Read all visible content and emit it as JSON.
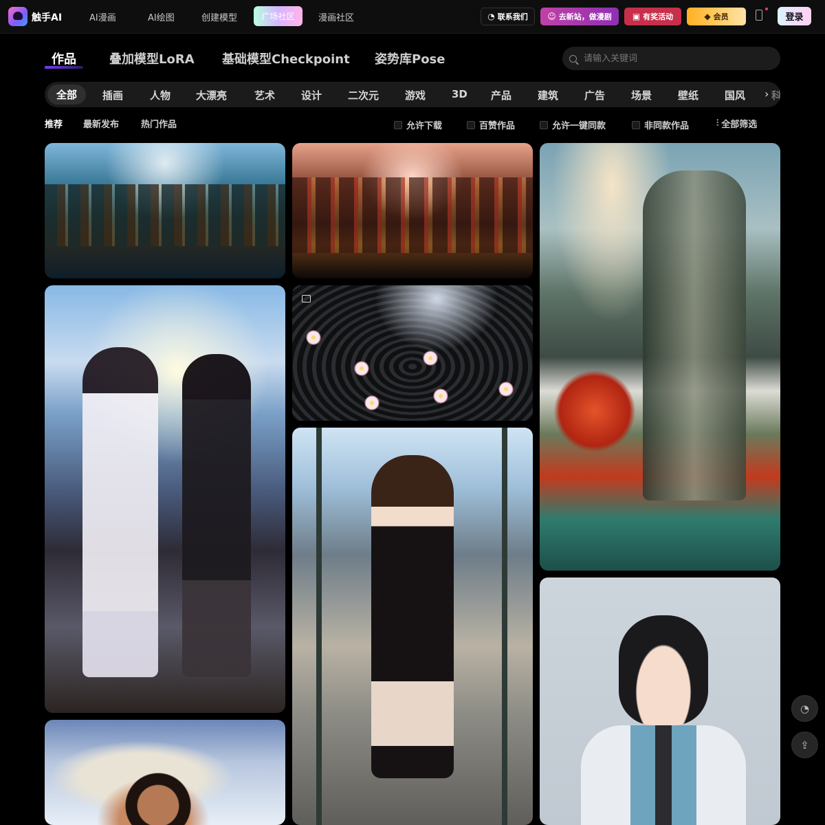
{
  "header": {
    "brand": "触手AI",
    "nav": [
      "AI漫画",
      "AI绘图",
      "创建模型",
      "广场社区",
      "漫画社区"
    ],
    "active_nav_index": 3,
    "buttons": {
      "contact": "联系我们",
      "new_site": "去新站，做漫剧",
      "events": "有奖活动",
      "vip": "会员",
      "login": "登录"
    }
  },
  "main_tabs": [
    "作品",
    "叠加模型LoRA",
    "基础模型Checkpoint",
    "姿势库Pose"
  ],
  "search": {
    "placeholder": "请输入关键词"
  },
  "categories": [
    "全部",
    "插画",
    "人物",
    "大漂亮",
    "艺术",
    "设计",
    "二次元",
    "游戏",
    "3D",
    "产品",
    "建筑",
    "广告",
    "场景",
    "壁纸",
    "国风",
    "科"
  ],
  "sort_tabs": [
    "推荐",
    "最新发布",
    "热门作品"
  ],
  "filters": [
    "允许下载",
    "百赞作品",
    "允许一键同款",
    "非同款作品"
  ],
  "all_filter": "全部筛选",
  "colors": {
    "background": "#000000",
    "panel": "#1b1b1b",
    "accent": "#7a3cff",
    "events_red": "#c72f4a",
    "vip_gold": "#ffb020"
  },
  "icons": {
    "logo": "brand-logo-icon",
    "contact": "wechat-icon",
    "search": "search-icon",
    "filter": "sliders-icon",
    "next": "chevron-right-icon"
  }
}
